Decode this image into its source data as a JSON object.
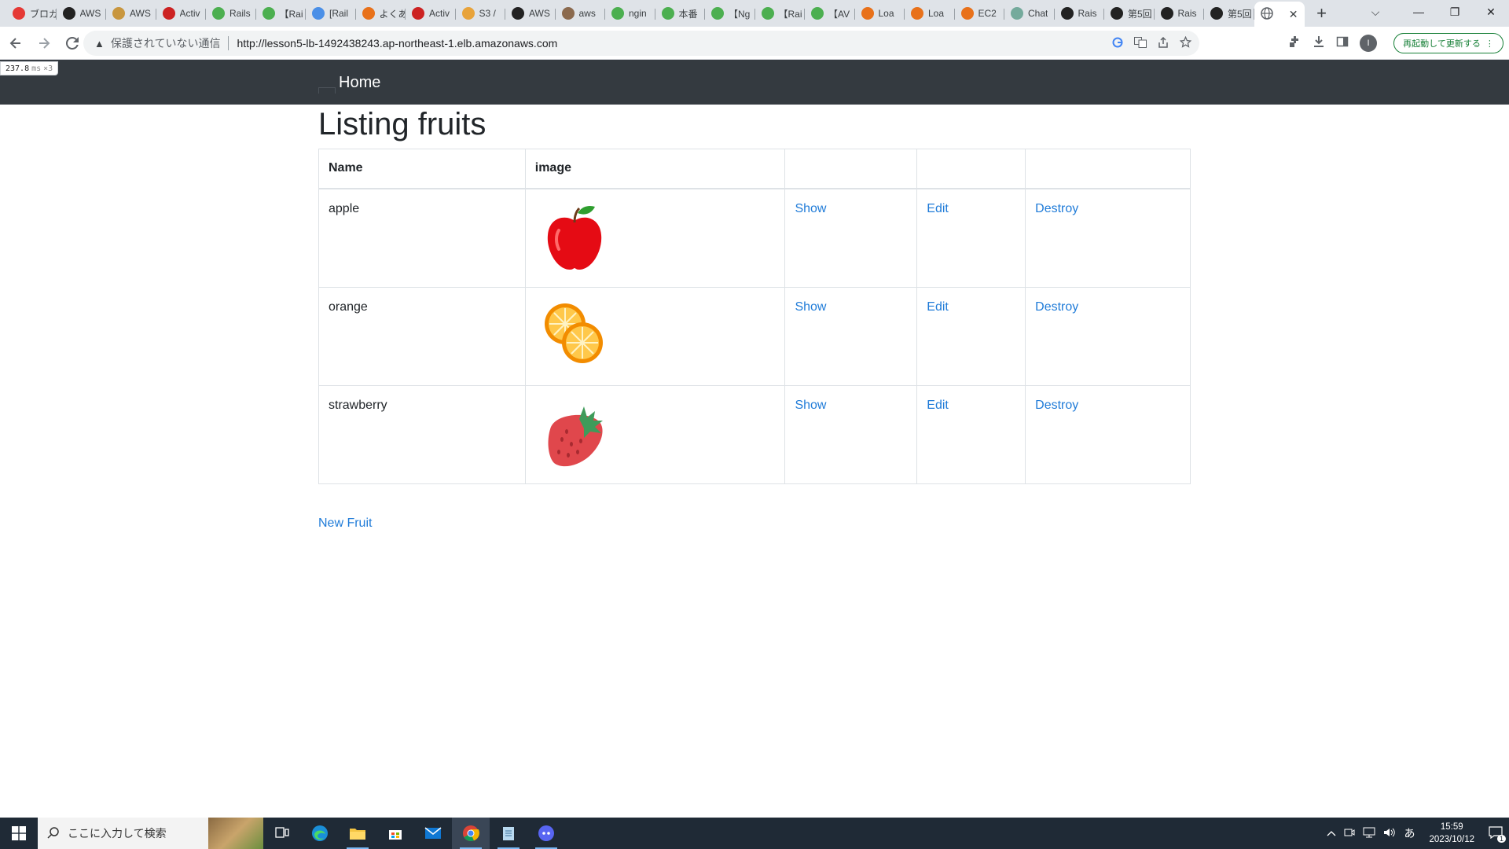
{
  "browser": {
    "tabs": [
      {
        "title": "ブロガ",
        "color": "#e53935"
      },
      {
        "title": "AWS",
        "color": "#222222"
      },
      {
        "title": "AWS",
        "color": "#c8963e"
      },
      {
        "title": "Activ",
        "color": "#cc2222"
      },
      {
        "title": "Rails",
        "color": "#4caf50"
      },
      {
        "title": "【Rai",
        "color": "#4caf50"
      },
      {
        "title": "[Rail",
        "color": "#4a8fe7"
      },
      {
        "title": "よくあ",
        "color": "#e8711a"
      },
      {
        "title": "Activ",
        "color": "#cc2222"
      },
      {
        "title": "S3 /",
        "color": "#e8a33a"
      },
      {
        "title": "AWS",
        "color": "#222222"
      },
      {
        "title": "aws",
        "color": "#8b6a4e"
      },
      {
        "title": "ngin",
        "color": "#4caf50"
      },
      {
        "title": "本番",
        "color": "#4caf50"
      },
      {
        "title": "【Ng",
        "color": "#4caf50"
      },
      {
        "title": "【Rai",
        "color": "#4caf50"
      },
      {
        "title": "【AV",
        "color": "#4caf50"
      },
      {
        "title": "Loa",
        "color": "#e8711a"
      },
      {
        "title": "Loa",
        "color": "#e8711a"
      },
      {
        "title": "EC2",
        "color": "#e8711a"
      },
      {
        "title": "Chat",
        "color": "#74aa9c"
      },
      {
        "title": "Rais",
        "color": "#222222"
      },
      {
        "title": "第5回",
        "color": "#222222"
      },
      {
        "title": "Rais",
        "color": "#222222"
      },
      {
        "title": "第5回",
        "color": "#222222"
      }
    ],
    "active_tab_close": "✕",
    "new_tab": "+",
    "window_controls": {
      "tab_search": "⌵",
      "minimize": "—",
      "maximize": "❐",
      "close": "✕"
    },
    "omnibox": {
      "warning_icon": "▲",
      "security_text": "保護されていない通信",
      "url": "http://lesson5-lb-1492438243.ap-northeast-1.elb.amazonaws.com"
    },
    "update_button": "再起動して更新する",
    "update_menu": "⋮",
    "profile_initial": "I"
  },
  "debug_badge": {
    "value": "237.8",
    "unit": "ms",
    "count": "×3"
  },
  "navbar": {
    "home": "Home"
  },
  "page": {
    "title": "Listing fruits",
    "table": {
      "headers": [
        "Name",
        "image",
        "",
        "",
        ""
      ],
      "rows": [
        {
          "name": "apple",
          "image": "apple-image",
          "show": "Show",
          "edit": "Edit",
          "destroy": "Destroy"
        },
        {
          "name": "orange",
          "image": "orange-image",
          "show": "Show",
          "edit": "Edit",
          "destroy": "Destroy"
        },
        {
          "name": "strawberry",
          "image": "strawberry-image",
          "show": "Show",
          "edit": "Edit",
          "destroy": "Destroy"
        }
      ]
    },
    "new_link": "New Fruit"
  },
  "colors": {
    "navbar_bg": "#343a40",
    "link": "#1f7bd8",
    "table_border": "#dee2e6"
  },
  "taskbar": {
    "search_placeholder": "ここに入力して検索",
    "clock_time": "15:59",
    "clock_date": "2023/10/12",
    "ime": "あ",
    "notification_count": "1"
  }
}
